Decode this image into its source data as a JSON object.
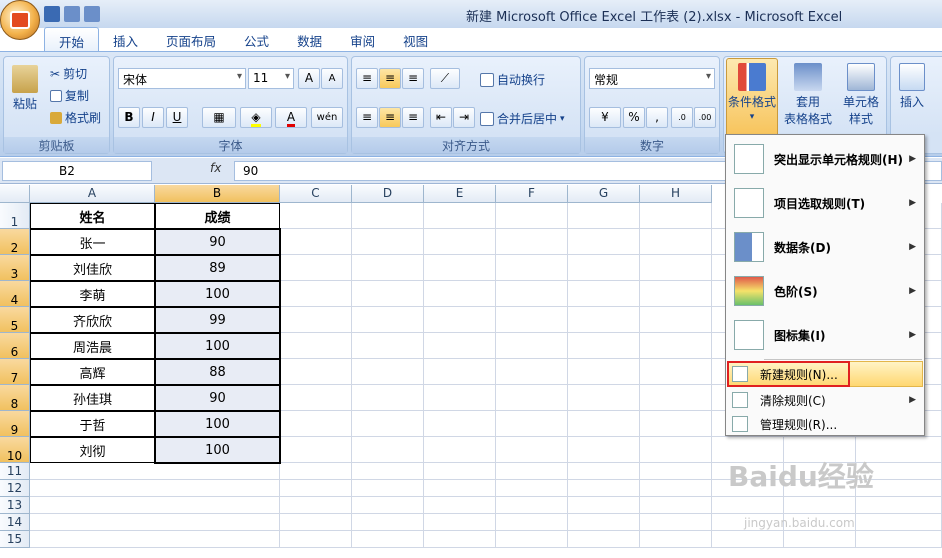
{
  "window": {
    "title": "新建 Microsoft Office Excel 工作表 (2).xlsx - Microsoft Excel"
  },
  "tabs": [
    "开始",
    "插入",
    "页面布局",
    "公式",
    "数据",
    "审阅",
    "视图"
  ],
  "ribbon": {
    "clipboard": {
      "paste": "粘贴",
      "cut": "剪切",
      "copy": "复制",
      "format_painter": "格式刷",
      "label": "剪贴板"
    },
    "font": {
      "name": "宋体",
      "size": "11",
      "grow": "A",
      "shrink": "A",
      "bold": "B",
      "italic": "I",
      "underline": "U",
      "wen": "wén",
      "label": "字体"
    },
    "alignment": {
      "wrap": "自动换行",
      "merge": "合并后居中",
      "label": "对齐方式"
    },
    "number": {
      "format": "常规",
      "percent": "%",
      "comma": ",",
      "label": "数字"
    },
    "styles": {
      "conditional": "条件格式",
      "table": "套用\n表格格式",
      "cell_styles": "单元格\n样式"
    },
    "cells": {
      "insert": "插入"
    }
  },
  "formula_bar": {
    "name_box": "B2",
    "fx": "fx",
    "value": "90"
  },
  "columns": [
    "A",
    "B",
    "C",
    "D",
    "E",
    "F",
    "G",
    "H"
  ],
  "rows": [
    "1",
    "2",
    "3",
    "4",
    "5",
    "6",
    "7",
    "8",
    "9",
    "10",
    "11",
    "12",
    "13",
    "14",
    "15"
  ],
  "sheet": {
    "headers": [
      "姓名",
      "成绩"
    ],
    "data": [
      [
        "张一",
        "90"
      ],
      [
        "刘佳欣",
        "89"
      ],
      [
        "李萌",
        "100"
      ],
      [
        "齐欣欣",
        "99"
      ],
      [
        "周浩晨",
        "100"
      ],
      [
        "高辉",
        "88"
      ],
      [
        "孙佳琪",
        "90"
      ],
      [
        "于哲",
        "100"
      ],
      [
        "刘彻",
        "100"
      ]
    ]
  },
  "cf_menu": {
    "highlight": "突出显示单元格规则(H)",
    "top_bottom": "项目选取规则(T)",
    "data_bars": "数据条(D)",
    "color_scales": "色阶(S)",
    "icon_sets": "图标集(I)",
    "new_rule": "新建规则(N)...",
    "clear_rules": "清除规则(C)",
    "manage_rules": "管理规则(R)..."
  },
  "watermark": {
    "brand": "Baidu经验",
    "url": "jingyan.baidu.com"
  },
  "colors": {
    "ribbon": "#c6daf2",
    "selected_header": "#f1c15f",
    "menu_highlight": "#ffd771",
    "annotation": "#e02020"
  }
}
